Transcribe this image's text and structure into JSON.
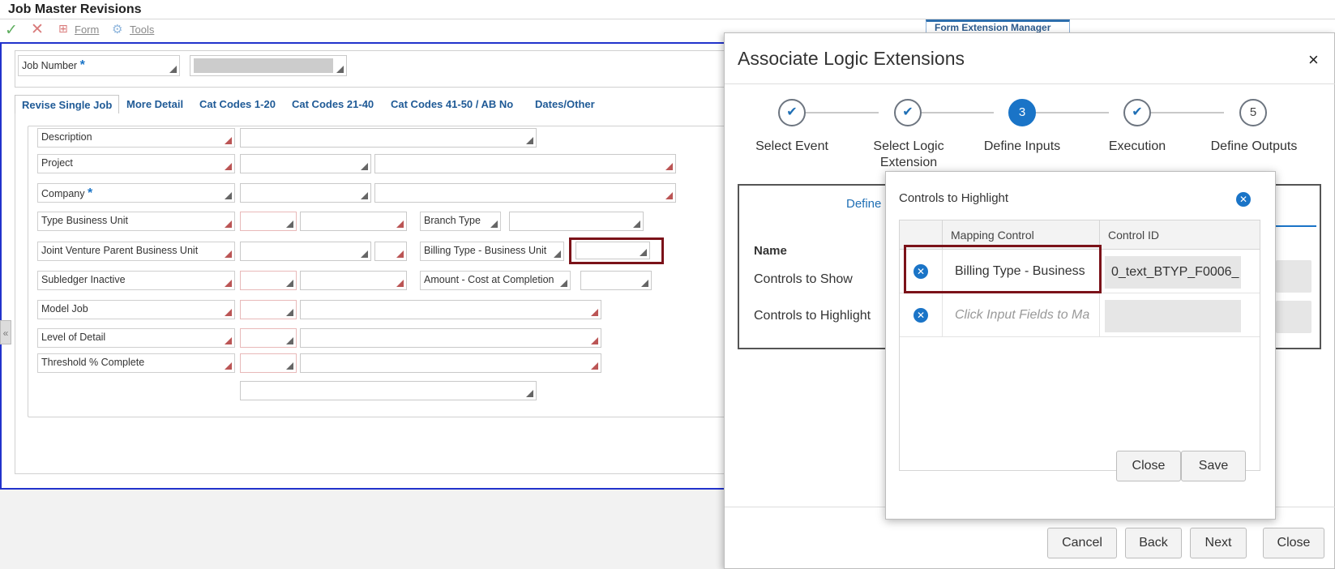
{
  "app": {
    "title": "Job Master Revisions"
  },
  "toolbar": {
    "form_label": "Form",
    "tools_label": "Tools",
    "form_extension_manager": "Form Extension Manager"
  },
  "header": {
    "job_number_label": "Job Number",
    "required_mark": "*"
  },
  "tabs": [
    {
      "label": "Revise Single Job"
    },
    {
      "label": "More Detail"
    },
    {
      "label": "Cat Codes 1-20"
    },
    {
      "label": "Cat Codes 21-40"
    },
    {
      "label": "Cat Codes 41-50 / AB No"
    },
    {
      "label": "Dates/Other"
    }
  ],
  "fields": {
    "description": "Description",
    "project": "Project",
    "company": "Company",
    "type_business_unit": "Type Business Unit",
    "branch_type": "Branch Type",
    "jv_parent_bu": "Joint Venture Parent Business Unit",
    "billing_type_bu": "Billing Type - Business Unit",
    "subledger_inactive": "Subledger Inactive",
    "amount_cost_completion": "Amount - Cost at Completion",
    "model_job": "Model Job",
    "level_of_detail": "Level of Detail",
    "threshold_complete": "Threshold % Complete"
  },
  "dialog": {
    "title": "Associate Logic Extensions",
    "close_glyph": "×",
    "steps": [
      {
        "label": "Select Event",
        "state": "done",
        "glyph": "✔"
      },
      {
        "label": "Select Logic Extension",
        "state": "done",
        "glyph": "✔"
      },
      {
        "label": "Define Inputs",
        "state": "current",
        "glyph": "3"
      },
      {
        "label": "Execution",
        "state": "done",
        "glyph": "✔"
      },
      {
        "label": "Define Outputs",
        "state": "future",
        "glyph": "5"
      }
    ],
    "define_link": "Define",
    "name_label": "Name",
    "controls_to_show": "Controls to Show",
    "controls_to_highlight": "Controls to Highlight",
    "buttons": {
      "cancel": "Cancel",
      "back": "Back",
      "next": "Next",
      "close": "Close"
    }
  },
  "popup": {
    "title": "Controls to Highlight",
    "close_glyph": "✕",
    "columns": {
      "mapping_control": "Mapping Control",
      "control_id": "Control ID"
    },
    "rows": [
      {
        "mapping_control": "Billing Type - Business",
        "control_id": "0_text_BTYP_F0006_",
        "placeholder": false
      },
      {
        "mapping_control": "Click Input Fields to Ma",
        "control_id": "",
        "placeholder": true
      }
    ],
    "buttons": {
      "close": "Close",
      "save": "Save"
    }
  },
  "colors": {
    "accent": "#1a74c7",
    "highlight": "#7b1219",
    "frame": "#2233cc"
  }
}
